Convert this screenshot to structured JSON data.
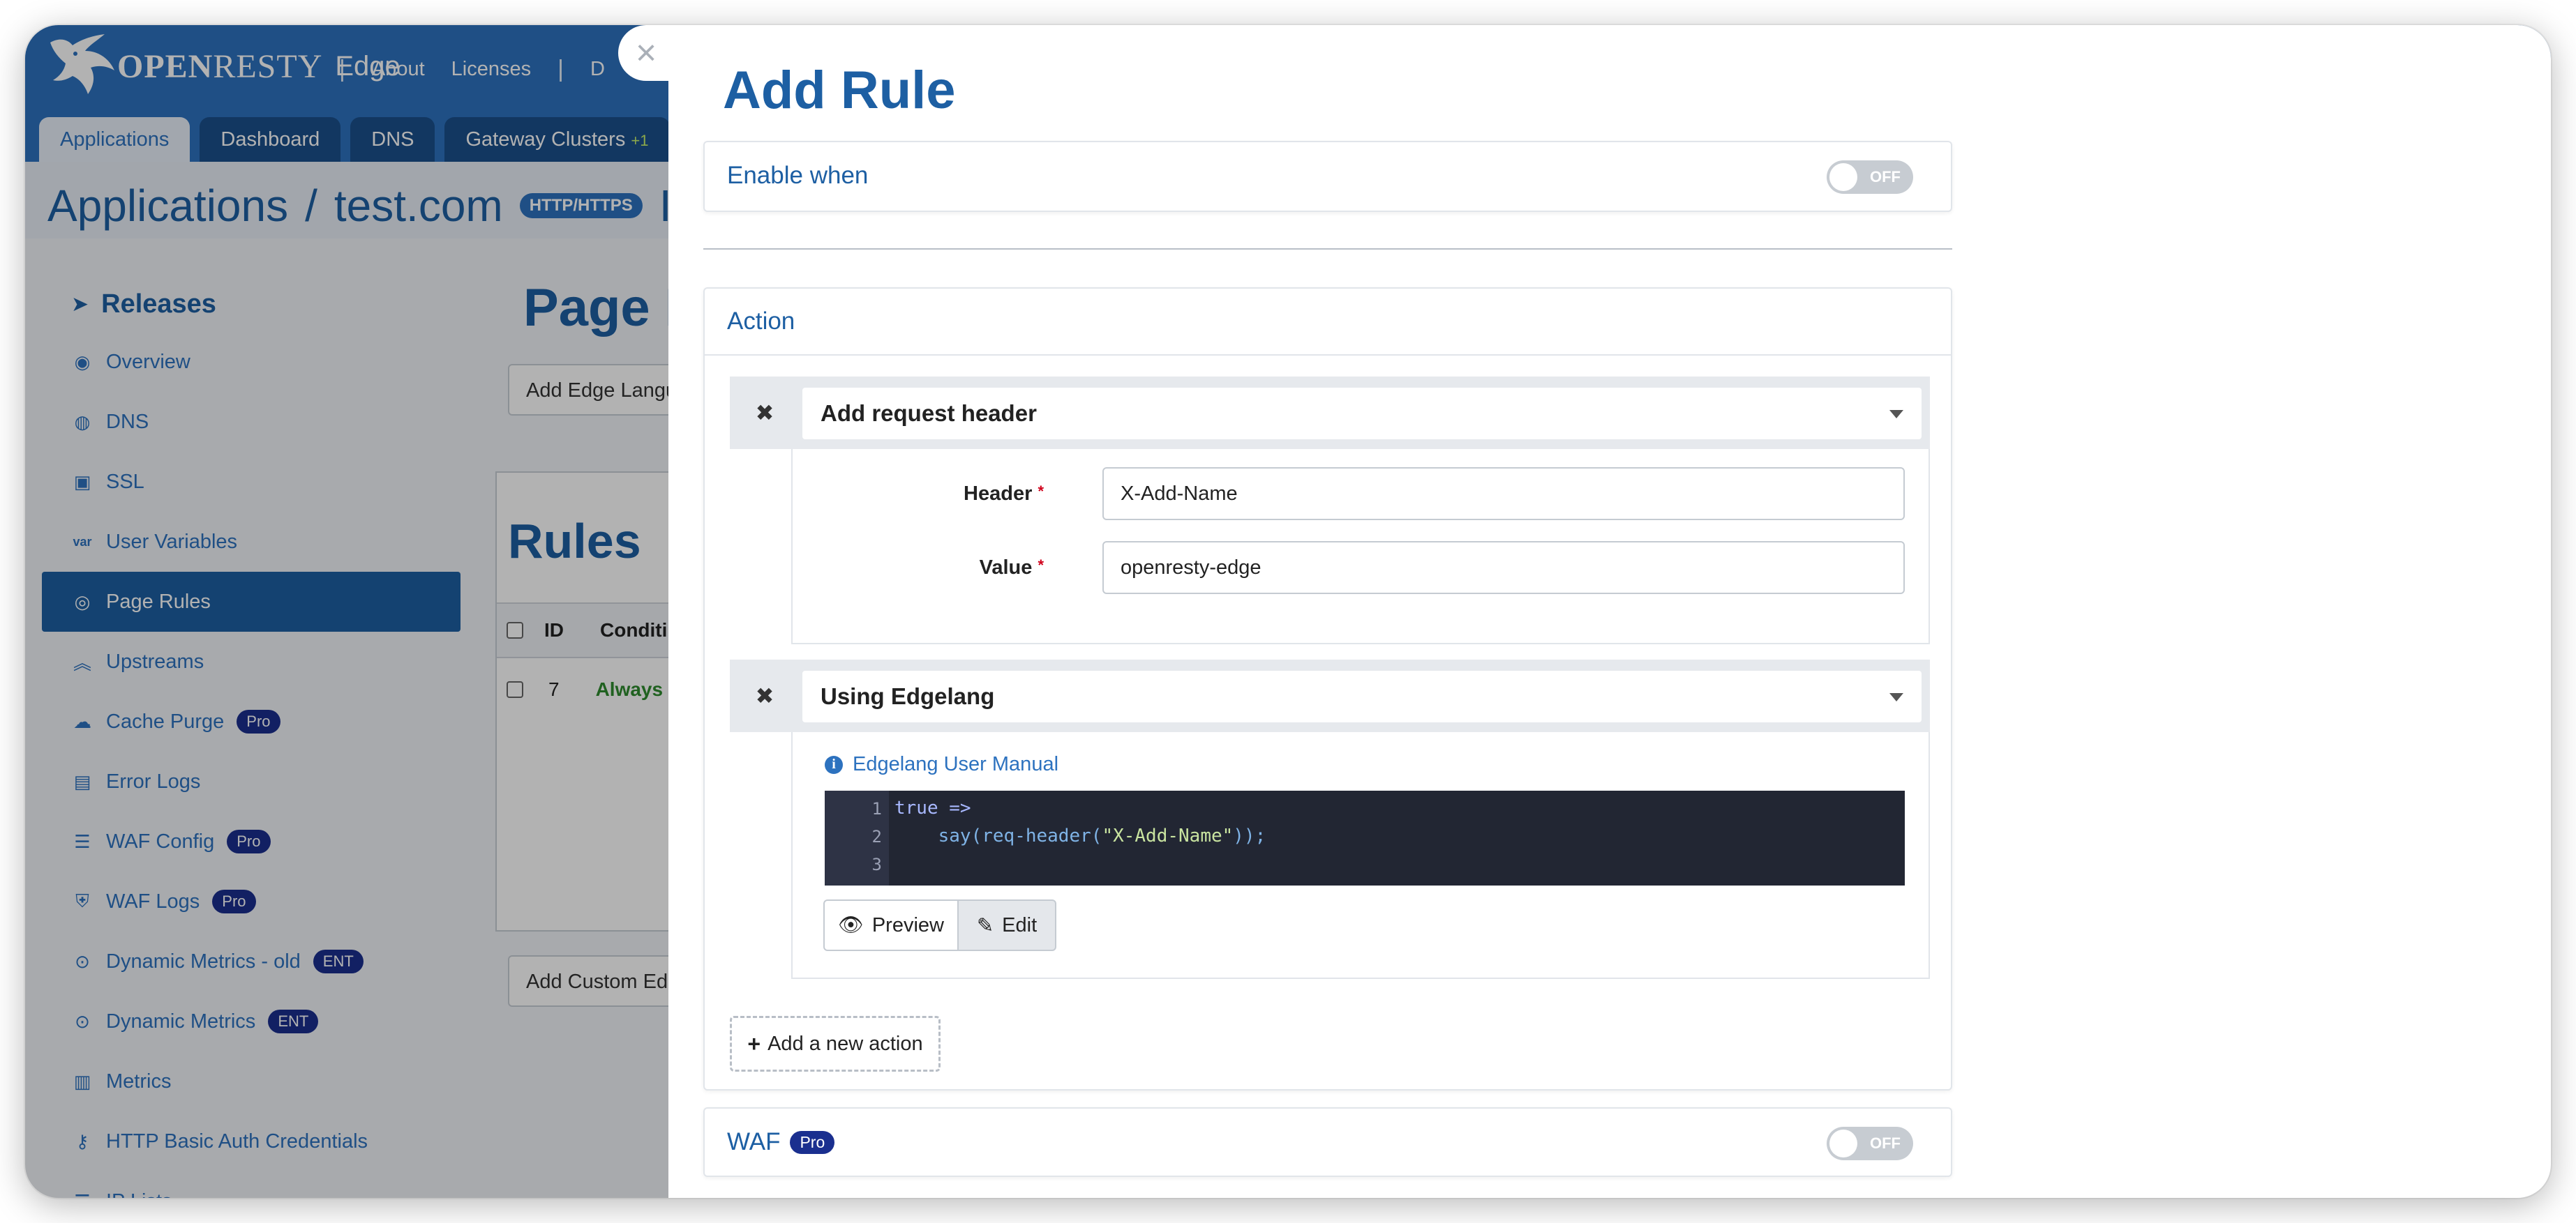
{
  "app": {
    "brand_bold": "OPEN",
    "brand_light": "RESTY",
    "product": "Edge",
    "topnav": [
      "About",
      "Licenses"
    ],
    "topnav_cut": "D",
    "tabs": [
      "Applications",
      "Dashboard",
      "DNS",
      "Gateway Clusters"
    ],
    "gateway_badge": "+1",
    "crumb_root": "Applications",
    "crumb_sep": "/",
    "crumb_app": "test.com",
    "proto_badge": "HTTP/HTTPS",
    "crumb_cut": "I"
  },
  "sidebar": {
    "heading": "Releases",
    "items": [
      {
        "label": "Overview",
        "icon": "gauge-icon"
      },
      {
        "label": "DNS",
        "icon": "globe-icon"
      },
      {
        "label": "SSL",
        "icon": "certificate-icon"
      },
      {
        "label": "User Variables",
        "icon": "var-icon"
      },
      {
        "label": "Page Rules",
        "icon": "compass-icon"
      },
      {
        "label": "Upstreams",
        "icon": "chevrons-up-icon"
      },
      {
        "label": "Cache Purge",
        "icon": "cloud-icon",
        "badge": "Pro"
      },
      {
        "label": "Error Logs",
        "icon": "log-icon"
      },
      {
        "label": "WAF Config",
        "icon": "list-icon",
        "badge": "Pro"
      },
      {
        "label": "WAF Logs",
        "icon": "shield-icon",
        "badge": "Pro"
      },
      {
        "label": "Dynamic Metrics - old",
        "icon": "pin-icon",
        "badge": "ENT"
      },
      {
        "label": "Dynamic Metrics",
        "icon": "pin-icon",
        "badge": "ENT"
      },
      {
        "label": "Metrics",
        "icon": "bar-chart-icon"
      },
      {
        "label": "HTTP Basic Auth Credentials",
        "icon": "key-icon"
      },
      {
        "label": "IP Lists",
        "icon": "list-icon"
      }
    ]
  },
  "content_bg": {
    "page_title": "Page R",
    "add_edge_btn": "Add Edge Langu",
    "rules_title": "Rules",
    "col_id": "ID",
    "col_condition": "Conditi",
    "row_id": "7",
    "row_condition": "Always",
    "add_custom_btn": "Add Custom Edg"
  },
  "modal": {
    "title": "Add Rule",
    "enable_when": "Enable when",
    "toggle_off": "OFF",
    "action_title": "Action",
    "action1": {
      "type": "Add request header",
      "header_label": "Header",
      "header_value": "X-Add-Name",
      "value_label": "Value",
      "value_value": "openresty-edge"
    },
    "action2": {
      "type": "Using Edgelang",
      "manual_link": "Edgelang User Manual",
      "code_lines": [
        "1",
        "2",
        "3"
      ],
      "code_kw": "true =>",
      "code_fn": "say(req-header(",
      "code_str": "\"X-Add-Name\"",
      "code_end": "));",
      "preview_btn": "Preview",
      "edit_btn": "Edit"
    },
    "add_action": "Add a new action",
    "waf_title": "WAF",
    "waf_badge": "Pro"
  }
}
